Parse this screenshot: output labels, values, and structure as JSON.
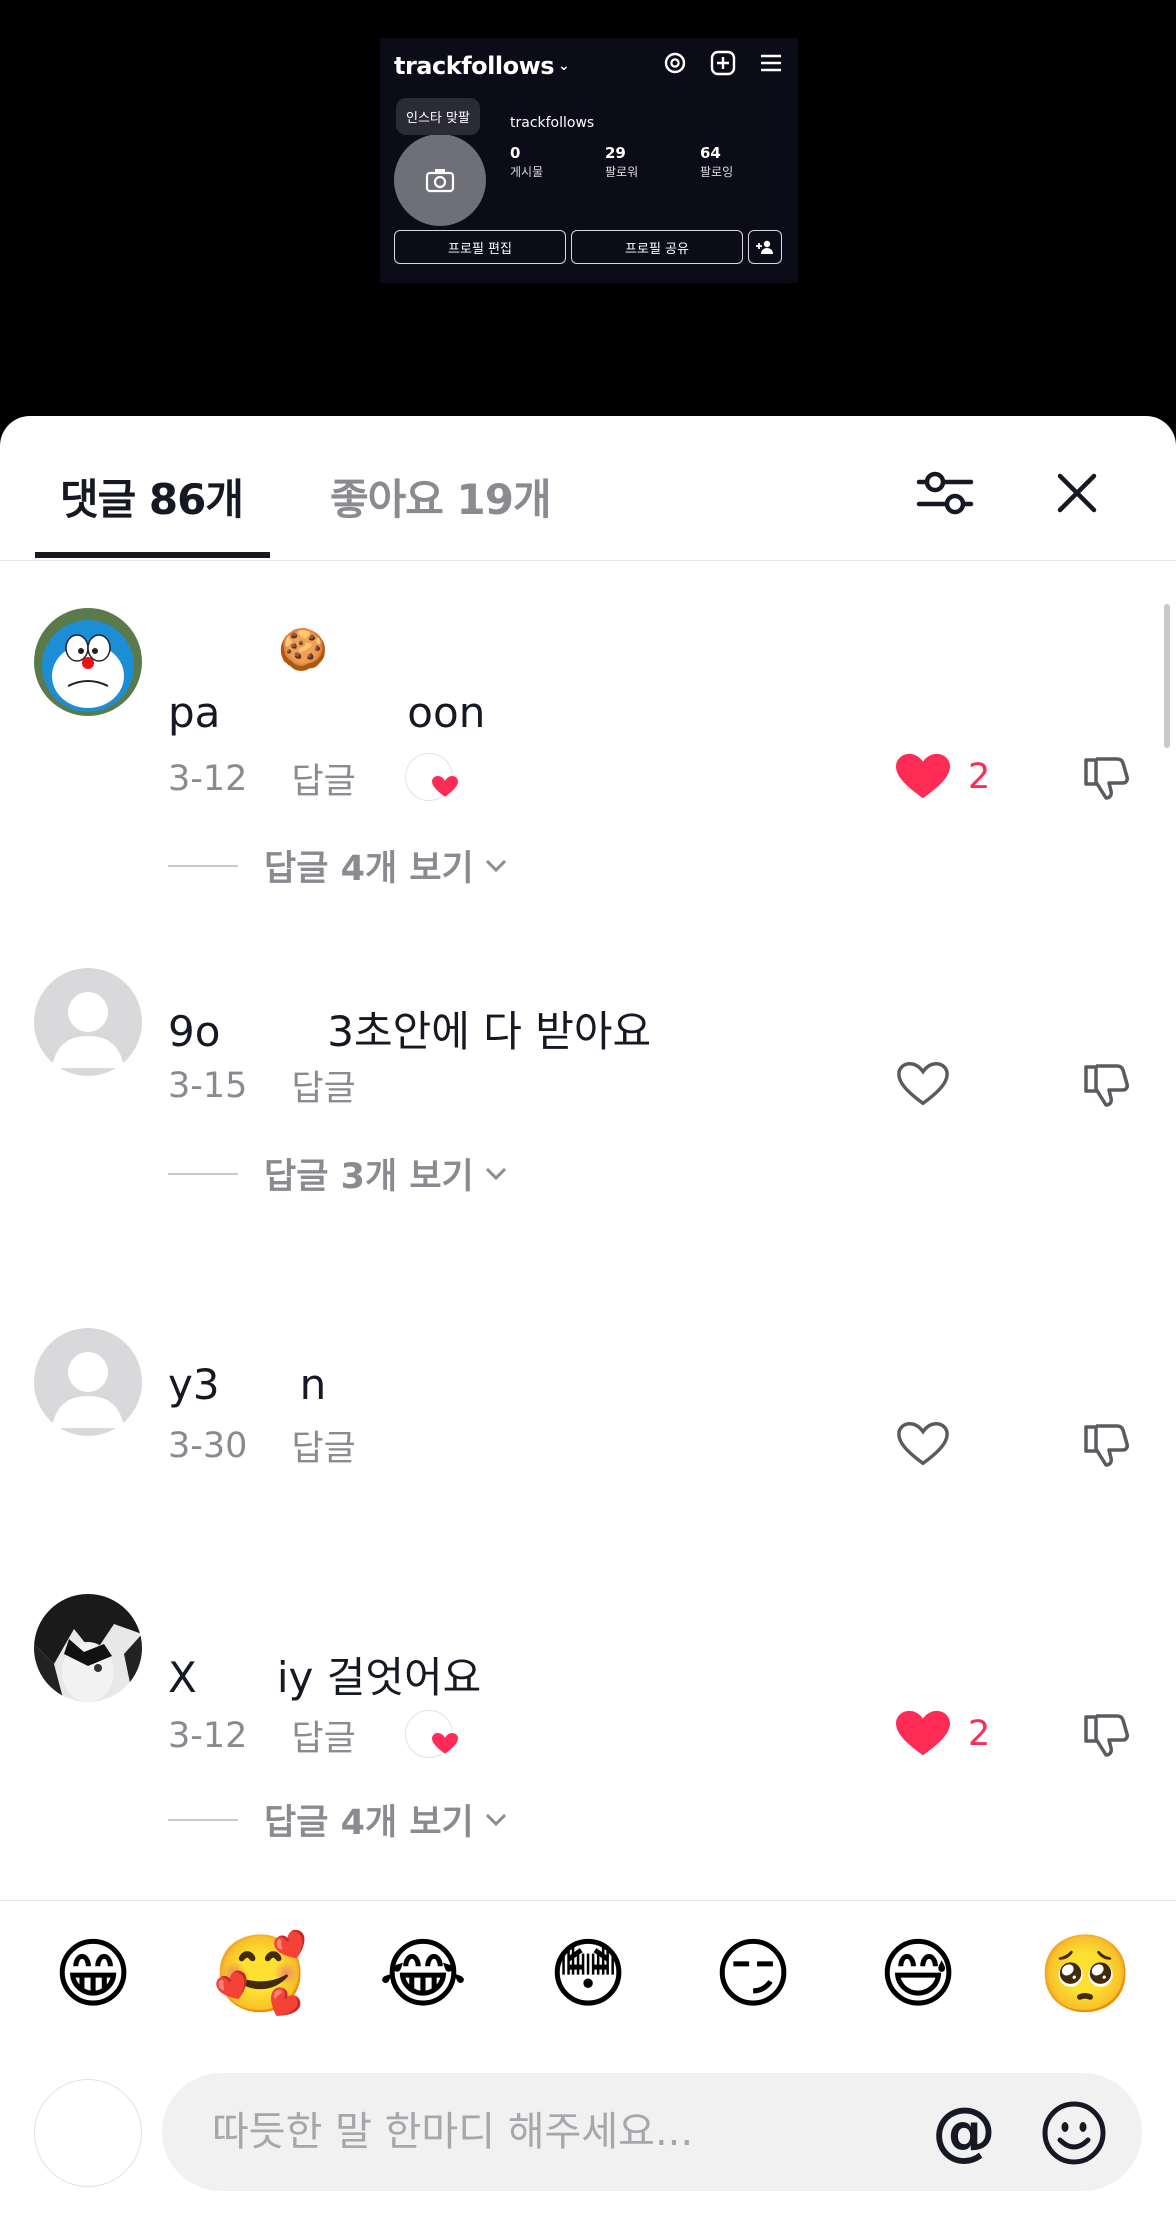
{
  "preview": {
    "username": "trackfollows",
    "tooltip": "인스타 맞팔",
    "handle": "trackfollows",
    "stats": [
      {
        "value": "0",
        "label": "게시물"
      },
      {
        "value": "29",
        "label": "팔로워"
      },
      {
        "value": "64",
        "label": "팔로잉"
      }
    ],
    "edit_button": "프로필 편집",
    "share_button": "프로필 공유",
    "icons": [
      "threads-icon",
      "add-post-icon",
      "menu-icon",
      "add-person-icon",
      "camera-icon"
    ]
  },
  "tabs": {
    "comments": "댓글 86개",
    "likes": "좋아요 19개"
  },
  "comments": [
    {
      "badge": "🍪",
      "text": "pa              oon",
      "date": "3-12",
      "reply": "답글",
      "creator_liked": true,
      "liked": true,
      "like_count": "2",
      "view_replies": "답글 4개 보기",
      "avatar": "doraemon"
    },
    {
      "text": "9o        3초안에 다 받아요",
      "date": "3-15",
      "reply": "답글",
      "creator_liked": false,
      "liked": false,
      "like_count": "",
      "view_replies": "답글 3개 보기",
      "avatar": "default"
    },
    {
      "text": "y3      n",
      "date": "3-30",
      "reply": "답글",
      "creator_liked": false,
      "liked": false,
      "like_count": "",
      "view_replies": "",
      "avatar": "default"
    },
    {
      "text": "X      iy 걸엇어요",
      "date": "3-12",
      "reply": "답글",
      "creator_liked": true,
      "liked": true,
      "like_count": "2",
      "view_replies": "답글 4개 보기",
      "avatar": "anime"
    }
  ],
  "emojis": [
    "😁",
    "🥰",
    "😂",
    "😳",
    "😏",
    "😅",
    "🥺"
  ],
  "composer": {
    "placeholder": "따듯한 말 한마디 해주세요...",
    "mention": "@"
  },
  "colors": {
    "accent": "#fe2c55",
    "text": "#161823",
    "muted": "#8a8b91"
  }
}
